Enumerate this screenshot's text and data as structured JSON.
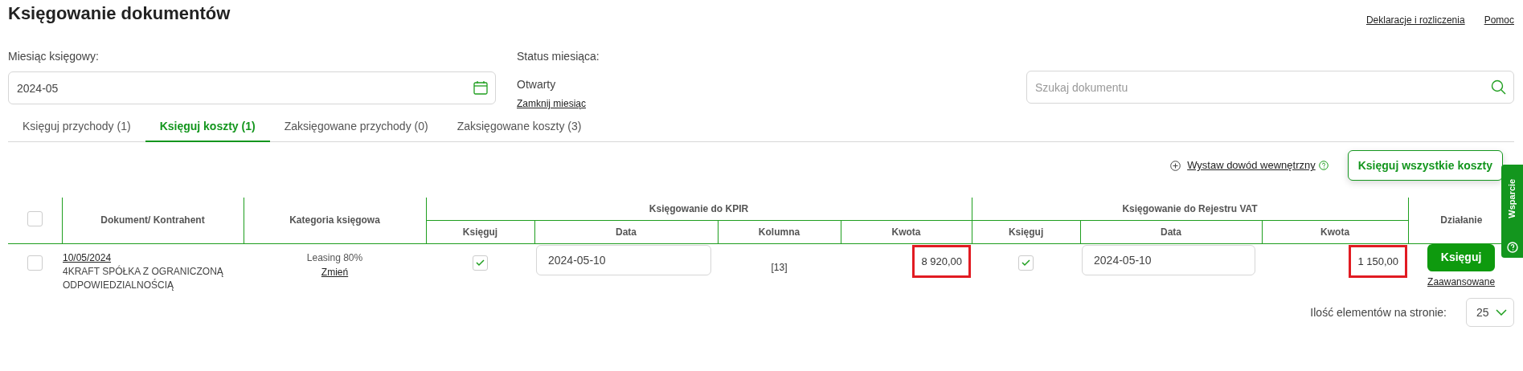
{
  "page_title": "Księgowanie dokumentów",
  "header_links": [
    "Deklaracje i rozliczenia",
    "Pomoc"
  ],
  "month": {
    "label": "Miesiąc księgowy:",
    "value": "2024-05"
  },
  "status": {
    "label": "Status miesiąca:",
    "value": "Otwarty",
    "link": "Zamknij miesiąc"
  },
  "search": {
    "placeholder": "Szukaj dokumentu"
  },
  "tabs": [
    {
      "label": "Księguj przychody (1)",
      "selected": false
    },
    {
      "label": "Księguj koszty (1)",
      "selected": true
    },
    {
      "label": "Zaksięgowane przychody (0)",
      "selected": false
    },
    {
      "label": "Zaksięgowane koszty (3)",
      "selected": false
    }
  ],
  "internal_link": "Wystaw dowód wewnętrzny",
  "bulk_button": "Księguj wszystkie koszty",
  "support_tab": "Wsparcie",
  "table": {
    "select_all": {
      "checked": false
    },
    "header_groups": [
      {
        "label": "Dokument/ Kontrahent"
      },
      {
        "label": "Kategoria księgowa"
      },
      {
        "label": "Księgowanie do KPIR",
        "subcolumns": [
          "Księguj",
          "Data",
          "Kolumna",
          "Kwota"
        ]
      },
      {
        "label": "Księgowanie do Rejestru VAT",
        "subcolumns": [
          "Księguj",
          "Data",
          "Kwota"
        ]
      },
      {
        "label": "Działanie"
      }
    ],
    "rows": [
      {
        "checked": false,
        "date": "10/05/2024",
        "contractor": "4KRAFT SPÓŁKA Z OGRANICZONĄ ODPOWIEDZIALNOŚCIĄ",
        "category": "Leasing 80%",
        "category_link": "Zmień",
        "kpir": {
          "book": true,
          "date": "2024-05-10",
          "column": "[13]",
          "amount": "8 920,00",
          "highlighted": true
        },
        "vat": {
          "book": true,
          "date": "2024-05-10",
          "amount": "1 150,00",
          "highlighted": true
        },
        "action": "Księguj",
        "advanced": "Zaawansowane"
      }
    ]
  },
  "pagination": {
    "label": "Ilość elementów na stronie:",
    "per_page": "25"
  }
}
